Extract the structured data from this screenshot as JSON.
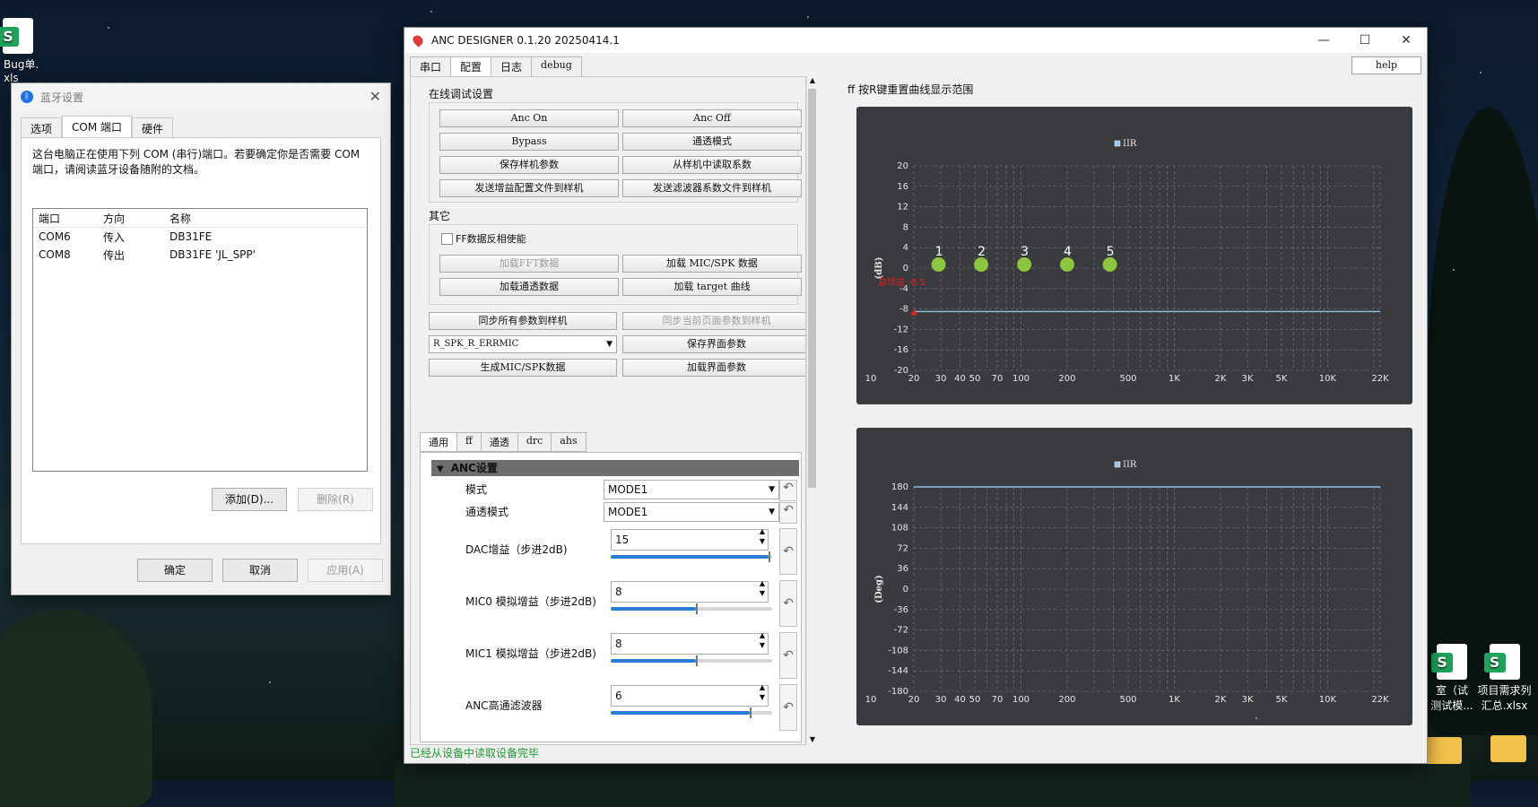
{
  "desktop": {
    "icons": [
      {
        "label": "Bug单.\nxls",
        "kind": "sheet"
      },
      {
        "label": "室（试\n测试模...",
        "kind": "sheet"
      },
      {
        "label": "项目需求列\n汇总.xlsx",
        "kind": "sheet"
      }
    ]
  },
  "bluetooth": {
    "title": "蓝牙设置",
    "tabs": [
      "选项",
      "COM 端口",
      "硬件"
    ],
    "active_tab": "COM 端口",
    "description": "这台电脑正在使用下列 COM (串行)端口。若要确定你是否需要 COM 端口，请阅读蓝牙设备随附的文档。",
    "columns": [
      "端口",
      "方向",
      "名称"
    ],
    "rows": [
      [
        "COM6",
        "传入",
        "DB31FE"
      ],
      [
        "COM8",
        "传出",
        "DB31FE 'JL_SPP'"
      ]
    ],
    "add_label": "添加(D)...",
    "remove_label": "删除(R)",
    "ok_label": "确定",
    "cancel_label": "取消",
    "apply_label": "应用(A)"
  },
  "anc": {
    "title": "ANC DESIGNER 0.1.20 20250414.1",
    "main_tabs": [
      "串口",
      "配置",
      "日志",
      "debug"
    ],
    "active_tab": "配置",
    "help_label": "help",
    "online": {
      "label": "在线调试设置",
      "anc_on": "Anc On",
      "anc_off": "Anc Off",
      "bypass": "Bypass",
      "transparent": "通透模式",
      "save_params": "保存样机参数",
      "read_coeffs": "从样机中读取系数",
      "send_gain": "发送增益配置文件到样机",
      "send_filter": "发送滤波器系数文件到样机"
    },
    "other": {
      "label": "其它",
      "ff_invert": "FF数据反相使能",
      "load_fft": "加载FFT数据",
      "load_mic_spk": "加载 MIC/SPK 数据",
      "load_transparent": "加载通透数据",
      "load_target": "加载 target 曲线"
    },
    "sync_all": "同步所有参数到样机",
    "sync_page": "同步当前页面参数到样机",
    "mic_select": "R_SPK_R_ERRMIC",
    "save_ui": "保存界面参数",
    "gen_mic_spk": "生成MIC/SPK数据",
    "load_ui": "加载界面参数",
    "sub_tabs": [
      "通用",
      "ff",
      "通透",
      "drc",
      "ahs"
    ],
    "active_sub_tab": "通用",
    "anc_settings": {
      "header": "ANC设置",
      "mode_label": "模式",
      "mode_value": "MODE1",
      "trans_label": "通透模式",
      "trans_value": "MODE1",
      "dac_label": "DAC增益（步进2dB)",
      "dac_value": "15",
      "dac_fill": 0.98,
      "mic0_label": "MIC0 模拟增益（步进2dB)",
      "mic0_value": "8",
      "mic0_fill": 0.53,
      "mic1_label": "MIC1 模拟增益（步进2dB)",
      "mic1_value": "8",
      "mic1_fill": 0.53,
      "hpf_label": "ANC高通滤波器",
      "hpf_value": "6",
      "hpf_fill": 0.86
    },
    "status": "已经从设备中读取设备完毕",
    "plot_title": "ff 按R键重置曲线显示范围"
  },
  "chart_data": [
    {
      "type": "line",
      "legend": [
        "IIR"
      ],
      "ylabel": "(dB)",
      "ylim": [
        -20,
        20
      ],
      "yticks": [
        20,
        16,
        12,
        8,
        4,
        0,
        -4,
        -8,
        -12,
        -16,
        -20
      ],
      "xscale": "log",
      "xticks": [
        {
          "v": 10,
          "label": "10"
        },
        {
          "v": 20,
          "label": "20"
        },
        {
          "v": 30,
          "label": "30"
        },
        {
          "v": 40,
          "label": "40"
        },
        {
          "v": 50,
          "label": "50"
        },
        {
          "v": 70,
          "label": "70"
        },
        {
          "v": 100,
          "label": "100"
        },
        {
          "v": 200,
          "label": "200"
        },
        {
          "v": 500,
          "label": "500"
        },
        {
          "v": 1000,
          "label": "1K"
        },
        {
          "v": 2000,
          "label": "2K"
        },
        {
          "v": 3000,
          "label": "3K"
        },
        {
          "v": 5000,
          "label": "5K"
        },
        {
          "v": 10000,
          "label": "10K"
        },
        {
          "v": 22000,
          "label": "22K"
        }
      ],
      "xlim": [
        20,
        22000
      ],
      "series": [
        {
          "name": "IIR",
          "x": [
            20,
            22000
          ],
          "values": [
            -8.5,
            -8.5
          ]
        }
      ],
      "points": [
        {
          "label": "1",
          "x": 29,
          "y": 0
        },
        {
          "label": "2",
          "x": 55,
          "y": 0
        },
        {
          "label": "3",
          "x": 105,
          "y": 0
        },
        {
          "label": "4",
          "x": 200,
          "y": 0
        },
        {
          "label": "5",
          "x": 380,
          "y": 0
        }
      ],
      "annotation": "总增益 -8.5"
    },
    {
      "type": "line",
      "legend": [
        "IIR"
      ],
      "ylabel": "(Deg)",
      "ylim": [
        -180,
        180
      ],
      "yticks": [
        180,
        144,
        108,
        72,
        36,
        0,
        -36,
        -72,
        -108,
        -144,
        -180
      ],
      "xscale": "log",
      "xticks": [
        {
          "v": 10,
          "label": "10"
        },
        {
          "v": 20,
          "label": "20"
        },
        {
          "v": 30,
          "label": "30"
        },
        {
          "v": 40,
          "label": "40"
        },
        {
          "v": 50,
          "label": "50"
        },
        {
          "v": 70,
          "label": "70"
        },
        {
          "v": 100,
          "label": "100"
        },
        {
          "v": 200,
          "label": "200"
        },
        {
          "v": 500,
          "label": "500"
        },
        {
          "v": 1000,
          "label": "1K"
        },
        {
          "v": 2000,
          "label": "2K"
        },
        {
          "v": 3000,
          "label": "3K"
        },
        {
          "v": 5000,
          "label": "5K"
        },
        {
          "v": 10000,
          "label": "10K"
        },
        {
          "v": 22000,
          "label": "22K"
        }
      ],
      "xlim": [
        20,
        22000
      ],
      "series": [
        {
          "name": "IIR",
          "x": [
            20,
            22000
          ],
          "values": [
            180,
            180
          ]
        }
      ]
    }
  ]
}
